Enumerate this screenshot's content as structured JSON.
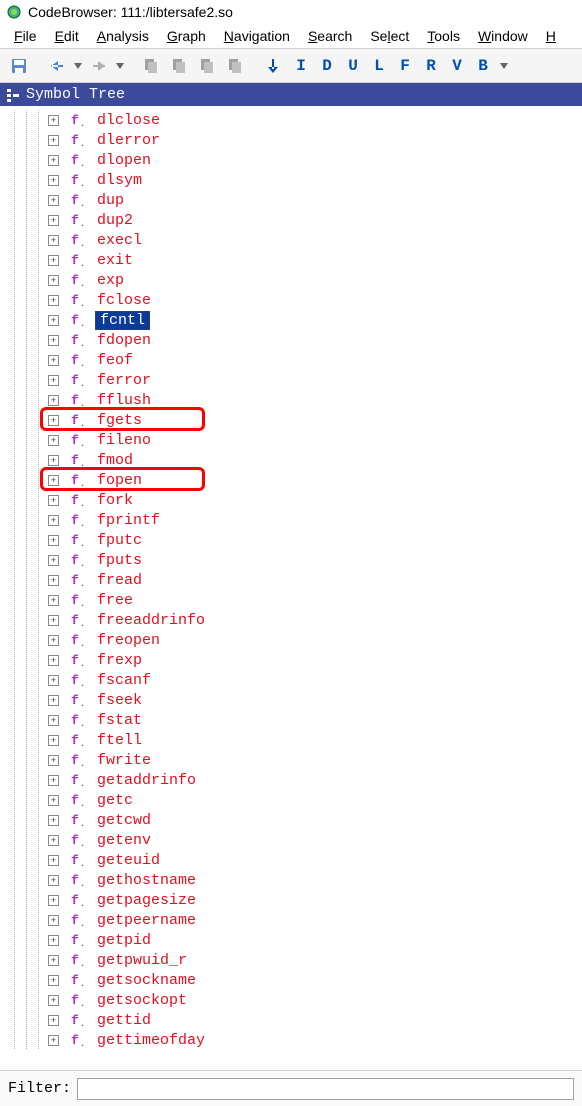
{
  "window": {
    "title": "CodeBrowser: 111:/libtersafe2.so"
  },
  "menu": {
    "items": [
      {
        "label": "File",
        "key": "F"
      },
      {
        "label": "Edit",
        "key": "E"
      },
      {
        "label": "Analysis",
        "key": "A"
      },
      {
        "label": "Graph",
        "key": "G"
      },
      {
        "label": "Navigation",
        "key": "N"
      },
      {
        "label": "Search",
        "key": "S"
      },
      {
        "label": "Select",
        "key": "l"
      },
      {
        "label": "Tools",
        "key": "T"
      },
      {
        "label": "Window",
        "key": "W"
      },
      {
        "label": "H",
        "key": "H"
      }
    ]
  },
  "toolbar": {
    "letters": [
      "I",
      "D",
      "U",
      "L",
      "F",
      "R",
      "V",
      "B"
    ]
  },
  "panel": {
    "title": "Symbol Tree"
  },
  "tree": {
    "items": [
      {
        "name": "dlclose",
        "selected": false
      },
      {
        "name": "dlerror",
        "selected": false
      },
      {
        "name": "dlopen",
        "selected": false
      },
      {
        "name": "dlsym",
        "selected": false
      },
      {
        "name": "dup",
        "selected": false
      },
      {
        "name": "dup2",
        "selected": false
      },
      {
        "name": "execl",
        "selected": false
      },
      {
        "name": "exit",
        "selected": false
      },
      {
        "name": "exp",
        "selected": false
      },
      {
        "name": "fclose",
        "selected": false
      },
      {
        "name": "fcntl",
        "selected": true
      },
      {
        "name": "fdopen",
        "selected": false
      },
      {
        "name": "feof",
        "selected": false
      },
      {
        "name": "ferror",
        "selected": false
      },
      {
        "name": "fflush",
        "selected": false
      },
      {
        "name": "fgets",
        "selected": false,
        "boxed": true
      },
      {
        "name": "fileno",
        "selected": false
      },
      {
        "name": "fmod",
        "selected": false
      },
      {
        "name": "fopen",
        "selected": false,
        "boxed": true
      },
      {
        "name": "fork",
        "selected": false
      },
      {
        "name": "fprintf",
        "selected": false
      },
      {
        "name": "fputc",
        "selected": false
      },
      {
        "name": "fputs",
        "selected": false
      },
      {
        "name": "fread",
        "selected": false
      },
      {
        "name": "free",
        "selected": false
      },
      {
        "name": "freeaddrinfo",
        "selected": false
      },
      {
        "name": "freopen",
        "selected": false
      },
      {
        "name": "frexp",
        "selected": false
      },
      {
        "name": "fscanf",
        "selected": false
      },
      {
        "name": "fseek",
        "selected": false
      },
      {
        "name": "fstat",
        "selected": false
      },
      {
        "name": "ftell",
        "selected": false
      },
      {
        "name": "fwrite",
        "selected": false
      },
      {
        "name": "getaddrinfo",
        "selected": false
      },
      {
        "name": "getc",
        "selected": false
      },
      {
        "name": "getcwd",
        "selected": false
      },
      {
        "name": "getenv",
        "selected": false
      },
      {
        "name": "geteuid",
        "selected": false
      },
      {
        "name": "gethostname",
        "selected": false
      },
      {
        "name": "getpagesize",
        "selected": false
      },
      {
        "name": "getpeername",
        "selected": false
      },
      {
        "name": "getpid",
        "selected": false
      },
      {
        "name": "getpwuid_r",
        "selected": false
      },
      {
        "name": "getsockname",
        "selected": false
      },
      {
        "name": "getsockopt",
        "selected": false
      },
      {
        "name": "gettid",
        "selected": false
      },
      {
        "name": "gettimeofday",
        "selected": false
      }
    ]
  },
  "filter": {
    "label": "Filter:",
    "value": ""
  }
}
